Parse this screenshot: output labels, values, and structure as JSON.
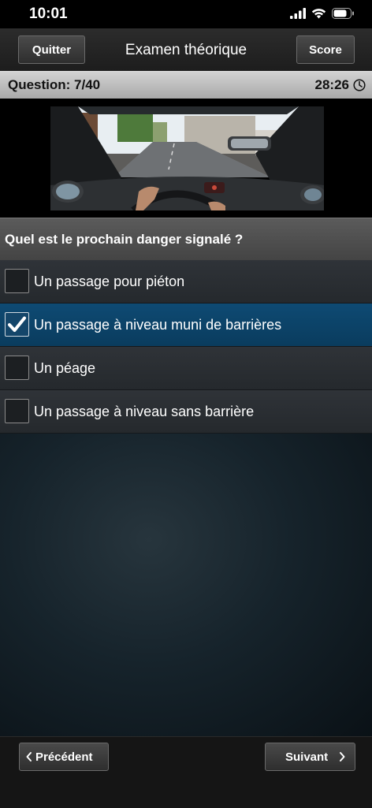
{
  "status": {
    "time": "10:01"
  },
  "nav": {
    "quit_label": "Quitter",
    "title": "Examen théorique",
    "score_label": "Score"
  },
  "info": {
    "question_counter": "Question: 7/40",
    "timer": "28:26"
  },
  "question": {
    "text": "Quel est le prochain danger signalé ?"
  },
  "answers": [
    {
      "label": "Un passage pour piéton",
      "checked": false
    },
    {
      "label": "Un passage à niveau muni de barrières",
      "checked": true
    },
    {
      "label": "Un péage",
      "checked": false
    },
    {
      "label": "Un passage à niveau sans barrière",
      "checked": false
    }
  ],
  "footer": {
    "prev_label": "Précédent",
    "next_label": "Suivant"
  },
  "icons": {
    "signal": "cellular-signal-icon",
    "wifi": "wifi-icon",
    "battery": "battery-icon",
    "clock": "clock-icon",
    "check": "checkmark-icon",
    "prev": "chevron-left-icon",
    "next": "chevron-right-icon"
  },
  "colors": {
    "selected_answer": "#0e4a73",
    "info_bar": "#c0c0c0"
  }
}
